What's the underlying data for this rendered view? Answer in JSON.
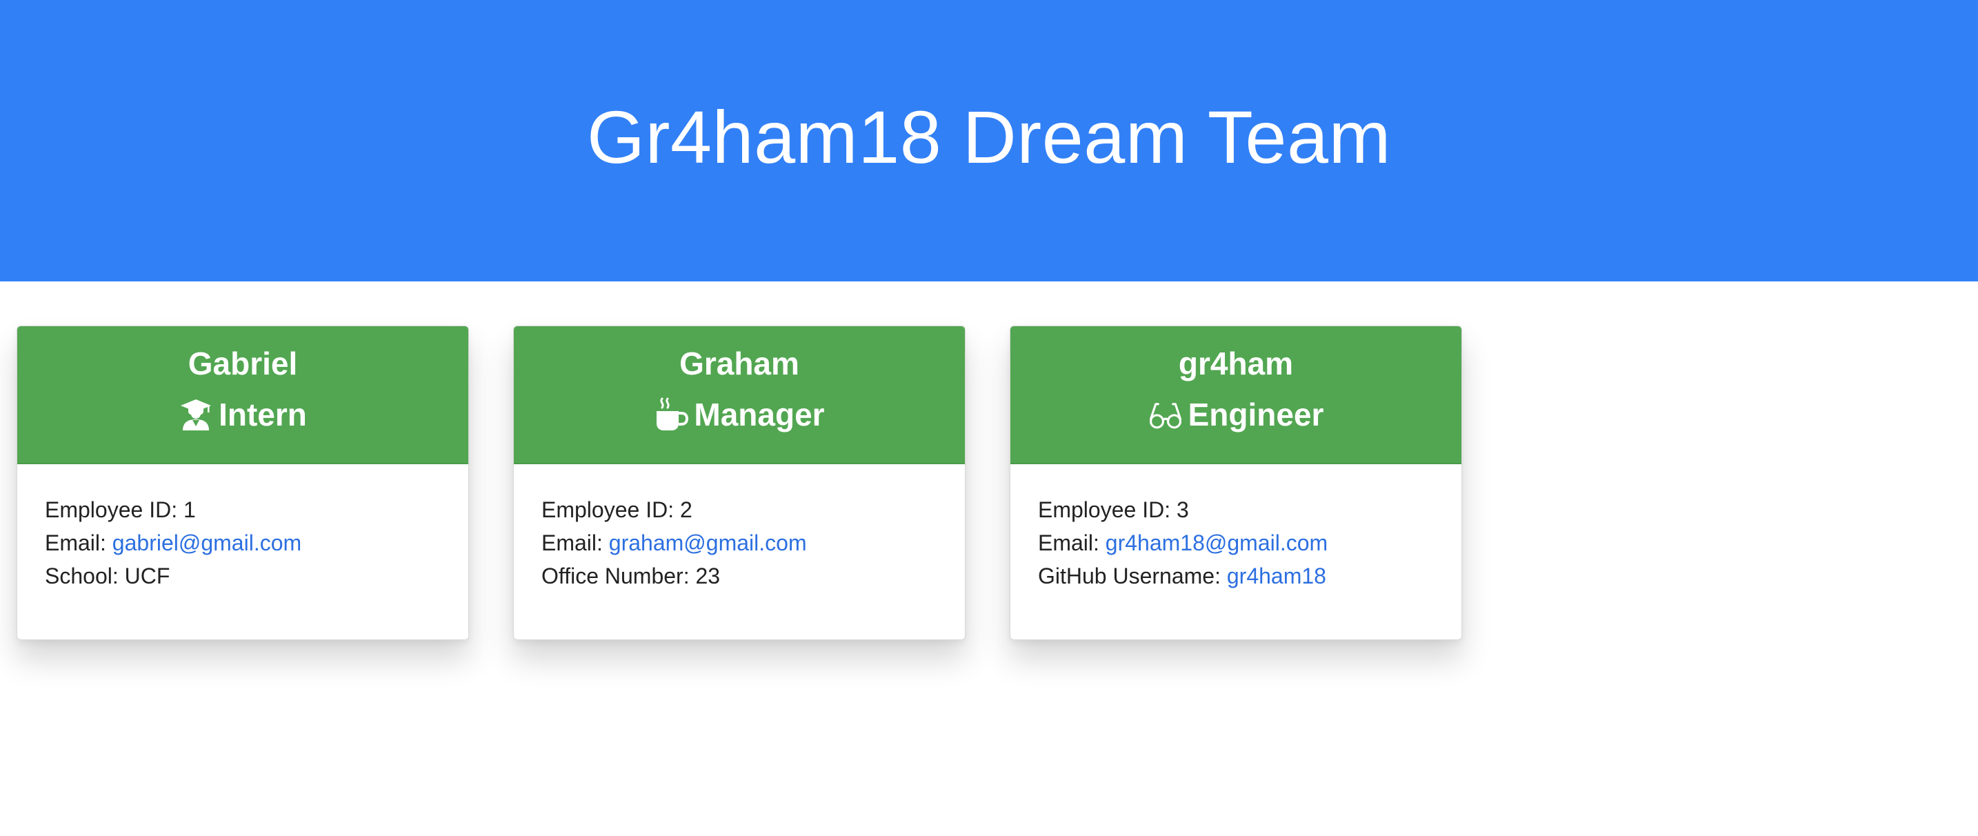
{
  "header": {
    "title": "Gr4ham18 Dream Team",
    "background": "#3280f6"
  },
  "theme": {
    "card_header_bg": "#52a651",
    "link_color": "#2c6fe0"
  },
  "employees": [
    {
      "name": "Gabriel",
      "role": "Intern",
      "icon": "graduate-icon",
      "id_label": "Employee ID:",
      "id": "1",
      "email_label": "Email:",
      "email": "gabriel@gmail.com",
      "extra_label": "School:",
      "extra_value": "UCF"
    },
    {
      "name": "Graham",
      "role": "Manager",
      "icon": "coffee-mug-icon",
      "id_label": "Employee ID:",
      "id": "2",
      "email_label": "Email:",
      "email": "graham@gmail.com",
      "extra_label": "Office Number:",
      "extra_value": "23"
    },
    {
      "name": "gr4ham",
      "role": "Engineer",
      "icon": "glasses-icon",
      "id_label": "Employee ID:",
      "id": "3",
      "email_label": "Email:",
      "email": "gr4ham18@gmail.com",
      "extra_label": "GitHub Username:",
      "extra_value": "gr4ham18"
    }
  ]
}
